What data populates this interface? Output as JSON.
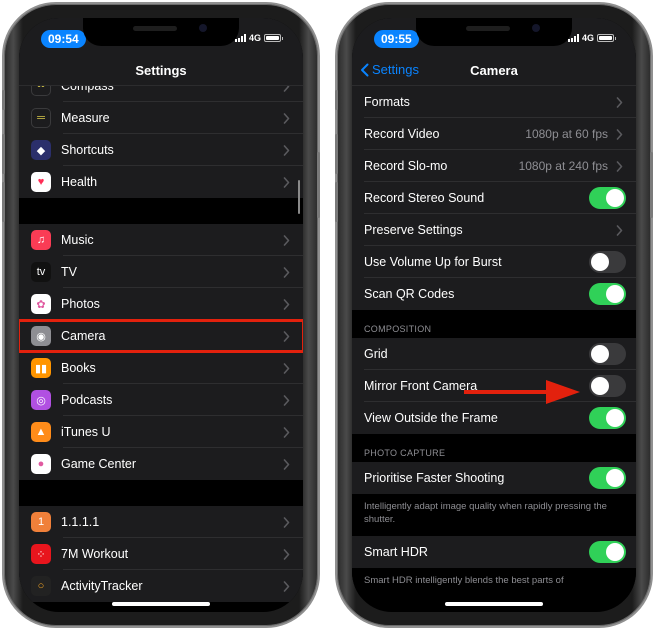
{
  "left_phone": {
    "status": {
      "time": "09:54",
      "network": "4G"
    },
    "nav": {
      "title": "Settings"
    },
    "groups": [
      {
        "items": [
          {
            "label": "Compass",
            "icon": "compass-icon",
            "icon_bg": "#1c1c1e",
            "glyph": "••"
          },
          {
            "label": "Measure",
            "icon": "measure-icon",
            "icon_bg": "#1c1c1e",
            "glyph": "═"
          },
          {
            "label": "Shortcuts",
            "icon": "shortcuts-icon",
            "icon_bg": "#2b2f6b",
            "glyph": "◆"
          },
          {
            "label": "Health",
            "icon": "health-icon",
            "icon_bg": "#ffffff",
            "glyph": "♥"
          }
        ]
      },
      {
        "items": [
          {
            "label": "Music",
            "icon": "music-icon",
            "icon_bg": "#fa3c55",
            "glyph": "♫"
          },
          {
            "label": "TV",
            "icon": "tv-icon",
            "icon_bg": "#111111",
            "glyph": "tv"
          },
          {
            "label": "Photos",
            "icon": "photos-icon",
            "icon_bg": "#ffffff",
            "glyph": "✿"
          },
          {
            "label": "Camera",
            "icon": "camera-icon",
            "icon_bg": "#8e8e93",
            "glyph": "◉"
          },
          {
            "label": "Books",
            "icon": "books-icon",
            "icon_bg": "#ff9500",
            "glyph": "▮▮"
          },
          {
            "label": "Podcasts",
            "icon": "podcasts-icon",
            "icon_bg": "#b150e2",
            "glyph": "◎"
          },
          {
            "label": "iTunes U",
            "icon": "itunes-u-icon",
            "icon_bg": "#ff8c1a",
            "glyph": "▲"
          },
          {
            "label": "Game Center",
            "icon": "game-center-icon",
            "icon_bg": "#ffffff",
            "glyph": "●"
          }
        ]
      },
      {
        "items": [
          {
            "label": "1.1.1.1",
            "icon": "one-one-one-one-icon",
            "icon_bg": "#f0803a",
            "glyph": "1"
          },
          {
            "label": "7M Workout",
            "icon": "seven-minute-workout-icon",
            "icon_bg": "#e8151d",
            "glyph": "⁘"
          },
          {
            "label": "ActivityTracker",
            "icon": "activity-tracker-icon",
            "icon_bg": "#222222",
            "glyph": "○"
          }
        ]
      }
    ],
    "highlighted_item": "Camera"
  },
  "right_phone": {
    "status": {
      "time": "09:55",
      "network": "4G"
    },
    "nav": {
      "back_label": "Settings",
      "title": "Camera"
    },
    "group1": [
      {
        "label": "Formats",
        "type": "link"
      },
      {
        "label": "Record Video",
        "type": "link",
        "detail": "1080p at 60 fps"
      },
      {
        "label": "Record Slo-mo",
        "type": "link",
        "detail": "1080p at 240 fps"
      },
      {
        "label": "Record Stereo Sound",
        "type": "toggle",
        "on": true
      },
      {
        "label": "Preserve Settings",
        "type": "link"
      },
      {
        "label": "Use Volume Up for Burst",
        "type": "toggle",
        "on": false
      },
      {
        "label": "Scan QR Codes",
        "type": "toggle",
        "on": true
      }
    ],
    "composition_header": "COMPOSITION",
    "composition": [
      {
        "label": "Grid",
        "type": "toggle",
        "on": false
      },
      {
        "label": "Mirror Front Camera",
        "type": "toggle",
        "on": false
      },
      {
        "label": "View Outside the Frame",
        "type": "toggle",
        "on": true
      }
    ],
    "photo_capture_header": "PHOTO CAPTURE",
    "photo_capture": [
      {
        "label": "Prioritise Faster Shooting",
        "type": "toggle",
        "on": true
      }
    ],
    "photo_capture_footer": "Intelligently adapt image quality when rapidly pressing the shutter.",
    "hdr": [
      {
        "label": "Smart HDR",
        "type": "toggle",
        "on": true
      }
    ],
    "hdr_footer": "Smart HDR intelligently blends the best parts of",
    "annotation_target": "Mirror Front Camera"
  },
  "colors": {
    "accent_blue": "#0a84ff",
    "toggle_on": "#30d158",
    "annotation_red": "#e3210d"
  }
}
